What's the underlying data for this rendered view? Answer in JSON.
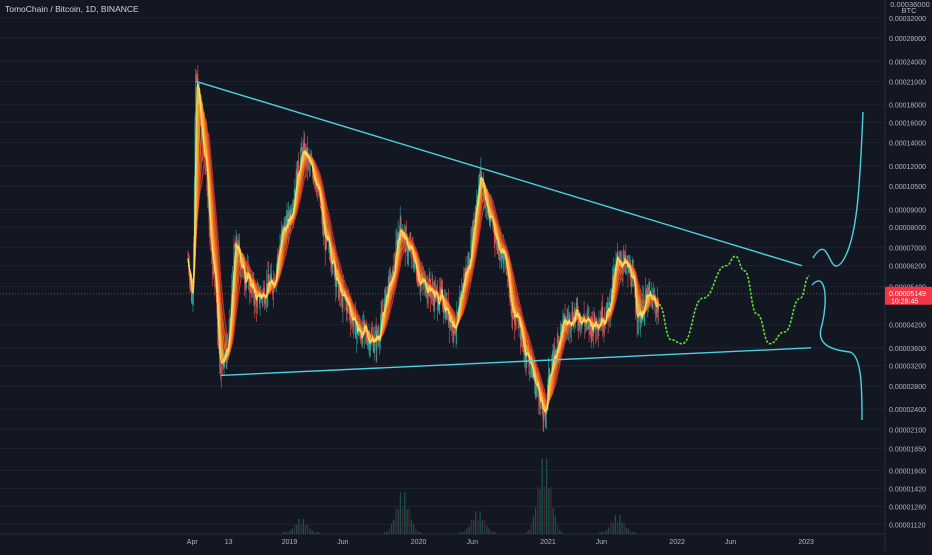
{
  "header": {
    "symbol_line": "TomoChain / Bitcoin, 1D, BINANCE"
  },
  "price_axis": {
    "currency": "BTC",
    "top_label": "0.00036000",
    "ticks": [
      "0.00032000",
      "0.00028000",
      "0.00024000",
      "0.00021000",
      "0.00018000",
      "0.00016000",
      "0.00014000",
      "0.00012000",
      "0.00010500",
      "0.00009000",
      "0.00008000",
      "0.00007000",
      "0.00006200",
      "0.00005400",
      "0.00004200",
      "0.00003600",
      "0.00003200",
      "0.00002800",
      "0.00002400",
      "0.00002100",
      "0.00001850",
      "0.00001600",
      "0.00001420",
      "0.00001260",
      "0.00001120"
    ]
  },
  "last_price": {
    "value": "0.00005149",
    "countdown": "10:28:45",
    "color": "#f23645"
  },
  "time_axis": {
    "ticks": [
      "Apr",
      "13",
      "2019",
      "Jun",
      "2020",
      "Jun",
      "2021",
      "Jun",
      "2022",
      "Jun",
      "2023"
    ]
  },
  "colors": {
    "background": "#131722",
    "trendline": "#4dd0e1",
    "projection": "#5dde3a",
    "candle_up": "#26a69a",
    "candle_down": "#ef5350",
    "ribbon_fast": "#ffe066",
    "ribbon_slow": "#e53935"
  },
  "chart_data": {
    "type": "candlestick",
    "title": "TomoChain / Bitcoin, 1D, BINANCE",
    "y_scale": "log",
    "yunit": "BTC",
    "ylim": [
      1.05e-05,
      0.00036
    ],
    "x_range": [
      "2018-03-20",
      "2023-04-01"
    ],
    "last_price": 5.149e-05,
    "price_path": [
      {
        "date": "2018-03-20",
        "price": 6.5e-05
      },
      {
        "date": "2018-04-01",
        "price": 5e-05
      },
      {
        "date": "2018-04-12",
        "price": 0.00021
      },
      {
        "date": "2018-05-05",
        "price": 0.00013
      },
      {
        "date": "2018-06-01",
        "price": 6e-05
      },
      {
        "date": "2018-06-20",
        "price": 3.3e-05
      },
      {
        "date": "2018-07-10",
        "price": 3.6e-05
      },
      {
        "date": "2018-08-01",
        "price": 7e-05
      },
      {
        "date": "2018-09-01",
        "price": 5.8e-05
      },
      {
        "date": "2018-10-01",
        "price": 5e-05
      },
      {
        "date": "2018-11-10",
        "price": 5.5e-05
      },
      {
        "date": "2018-12-20",
        "price": 8e-05
      },
      {
        "date": "2019-02-10",
        "price": 0.00013
      },
      {
        "date": "2019-03-10",
        "price": 0.000115
      },
      {
        "date": "2019-04-20",
        "price": 7e-05
      },
      {
        "date": "2019-06-01",
        "price": 5e-05
      },
      {
        "date": "2019-07-20",
        "price": 4e-05
      },
      {
        "date": "2019-09-01",
        "price": 3.8e-05
      },
      {
        "date": "2019-10-15",
        "price": 5.5e-05
      },
      {
        "date": "2019-11-10",
        "price": 8e-05
      },
      {
        "date": "2019-12-01",
        "price": 7e-05
      },
      {
        "date": "2020-01-15",
        "price": 5.5e-05
      },
      {
        "date": "2020-03-01",
        "price": 5e-05
      },
      {
        "date": "2020-04-15",
        "price": 4.2e-05
      },
      {
        "date": "2020-05-15",
        "price": 6e-05
      },
      {
        "date": "2020-06-25",
        "price": 0.00011
      },
      {
        "date": "2020-07-20",
        "price": 8.5e-05
      },
      {
        "date": "2020-08-20",
        "price": 7e-05
      },
      {
        "date": "2020-10-01",
        "price": 4.5e-05
      },
      {
        "date": "2020-11-01",
        "price": 3.5e-05
      },
      {
        "date": "2020-12-01",
        "price": 2.8e-05
      },
      {
        "date": "2020-12-20",
        "price": 2.3e-05
      },
      {
        "date": "2021-01-10",
        "price": 3.2e-05
      },
      {
        "date": "2021-02-15",
        "price": 4.2e-05
      },
      {
        "date": "2021-03-20",
        "price": 4.5e-05
      },
      {
        "date": "2021-05-01",
        "price": 4.2e-05
      },
      {
        "date": "2021-06-15",
        "price": 4.5e-05
      },
      {
        "date": "2021-07-20",
        "price": 6.5e-05
      },
      {
        "date": "2021-08-20",
        "price": 6e-05
      },
      {
        "date": "2021-09-15",
        "price": 4.5e-05
      },
      {
        "date": "2021-10-10",
        "price": 5e-05
      },
      {
        "date": "2021-11-10",
        "price": 4.8e-05
      }
    ],
    "volume_spikes": [
      {
        "date": "2019-02-01",
        "relative": 0.2
      },
      {
        "date": "2019-11-15",
        "relative": 0.55
      },
      {
        "date": "2020-06-15",
        "relative": 0.3
      },
      {
        "date": "2020-12-20",
        "relative": 1.0
      },
      {
        "date": "2021-07-15",
        "relative": 0.25
      }
    ],
    "upper_trendline": {
      "from": {
        "date": "2018-04-12",
        "price": 0.00021
      },
      "to": {
        "date": "2022-12-20",
        "price": 6.2e-05
      }
    },
    "lower_trendline": {
      "from": {
        "date": "2018-06-20",
        "price": 3e-05
      },
      "to": {
        "date": "2023-01-15",
        "price": 3.6e-05
      }
    },
    "projection_path": [
      {
        "date": "2021-11-10",
        "price": 4.8e-05
      },
      {
        "date": "2021-12-15",
        "price": 3.8e-05
      },
      {
        "date": "2022-01-15",
        "price": 3.7e-05
      },
      {
        "date": "2022-03-15",
        "price": 5e-05
      },
      {
        "date": "2022-05-20",
        "price": 6.2e-05
      },
      {
        "date": "2022-06-15",
        "price": 6.6e-05
      },
      {
        "date": "2022-07-10",
        "price": 6e-05
      },
      {
        "date": "2022-08-15",
        "price": 4.5e-05
      },
      {
        "date": "2022-09-20",
        "price": 3.7e-05
      },
      {
        "date": "2022-11-01",
        "price": 4e-05
      },
      {
        "date": "2022-12-15",
        "price": 5e-05
      },
      {
        "date": "2023-01-10",
        "price": 5.8e-05
      }
    ]
  }
}
